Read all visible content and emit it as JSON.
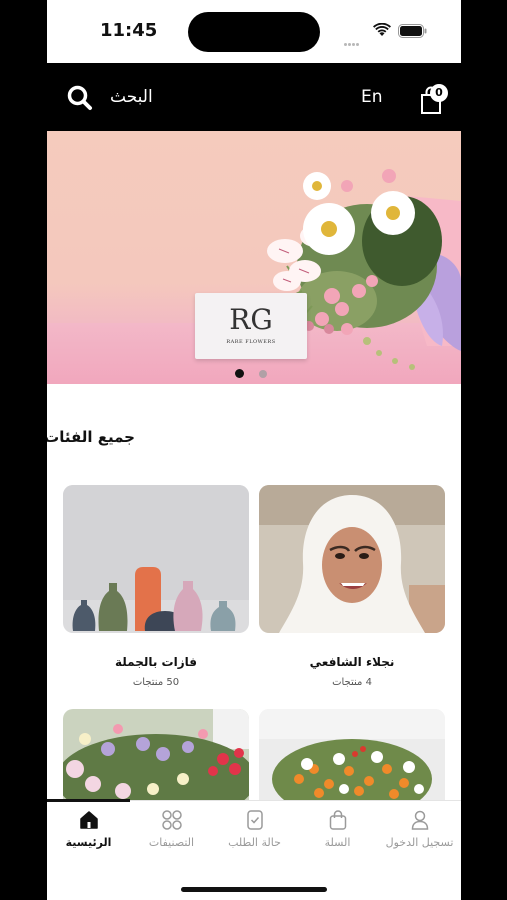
{
  "status_bar": {
    "time": "11:45"
  },
  "header": {
    "search_label": "البحث",
    "language_label": "En",
    "cart_count": "0",
    "colors": {
      "background": "#000000",
      "text": "#ffffff"
    }
  },
  "banner": {
    "logo_text": "RG",
    "logo_subtext": "RARE FLOWERS",
    "slide_count": 2,
    "active_slide": 1
  },
  "categories_section": {
    "title": "جميع الفئات",
    "items": [
      {
        "name": "نجلاء الشافعي",
        "count": "4 منتجات",
        "image": "portrait-photo"
      },
      {
        "name": "فازات بالجملة",
        "count": "50 منتجات",
        "image": "vases-photo"
      },
      {
        "name": "",
        "count": "",
        "image": "flower-arrangement-photo"
      },
      {
        "name": "",
        "count": "",
        "image": "flower-shop-photo"
      }
    ]
  },
  "tab_bar": {
    "items": [
      {
        "label": "تسجيل الدخول",
        "icon": "person-icon"
      },
      {
        "label": "السلة",
        "icon": "shopping-bag-icon"
      },
      {
        "label": "حالة الطلب",
        "icon": "order-status-icon"
      },
      {
        "label": "التصنيفات",
        "icon": "grid-icon"
      },
      {
        "label": "الرئيسية",
        "icon": "home-icon"
      }
    ],
    "active_index": 4,
    "colors": {
      "active": "#111111",
      "inactive": "#9a9a9a"
    }
  }
}
